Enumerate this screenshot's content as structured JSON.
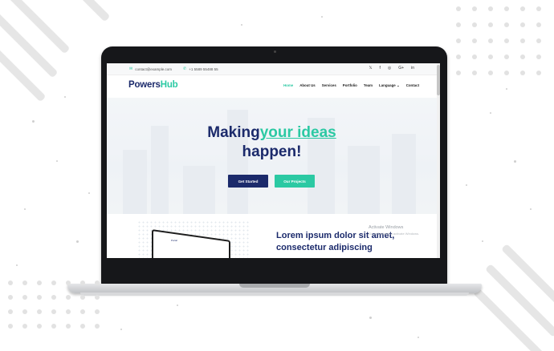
{
  "topbar": {
    "email": "contact@example.com",
    "phone": "+1 5589 55488 55",
    "email_icon": "envelope-icon",
    "phone_icon": "phone-icon",
    "social": [
      {
        "name": "twitter-icon",
        "glyph": "𝕏"
      },
      {
        "name": "facebook-icon",
        "glyph": "f"
      },
      {
        "name": "instagram-icon",
        "glyph": "◎"
      },
      {
        "name": "google-plus-icon",
        "glyph": "G+"
      },
      {
        "name": "linkedin-icon",
        "glyph": "in"
      }
    ]
  },
  "brand": {
    "part1": "Powers",
    "part2": "Hub",
    "primary_color": "#1b2a6b",
    "accent_color": "#2bc9a3"
  },
  "nav": {
    "items": [
      {
        "label": "Home",
        "active": true
      },
      {
        "label": "About Us",
        "active": false
      },
      {
        "label": "Services",
        "active": false
      },
      {
        "label": "Portfolio",
        "active": false
      },
      {
        "label": "Team",
        "active": false
      },
      {
        "label": "Language",
        "active": false,
        "dropdown": true
      },
      {
        "label": "Contact",
        "active": false
      }
    ]
  },
  "hero": {
    "line1_prefix": "Making",
    "line1_accent": "your ideas",
    "line2": "happen!",
    "primary_button": "Get Started",
    "secondary_button": "Our Projects"
  },
  "section2": {
    "title": "Lorem ipsum dolor sit amet, consectetur adipiscing",
    "device_label": "Portal"
  },
  "watermark": {
    "title": "Activate Windows",
    "subtitle": "Go to Settings to activate Windows."
  }
}
